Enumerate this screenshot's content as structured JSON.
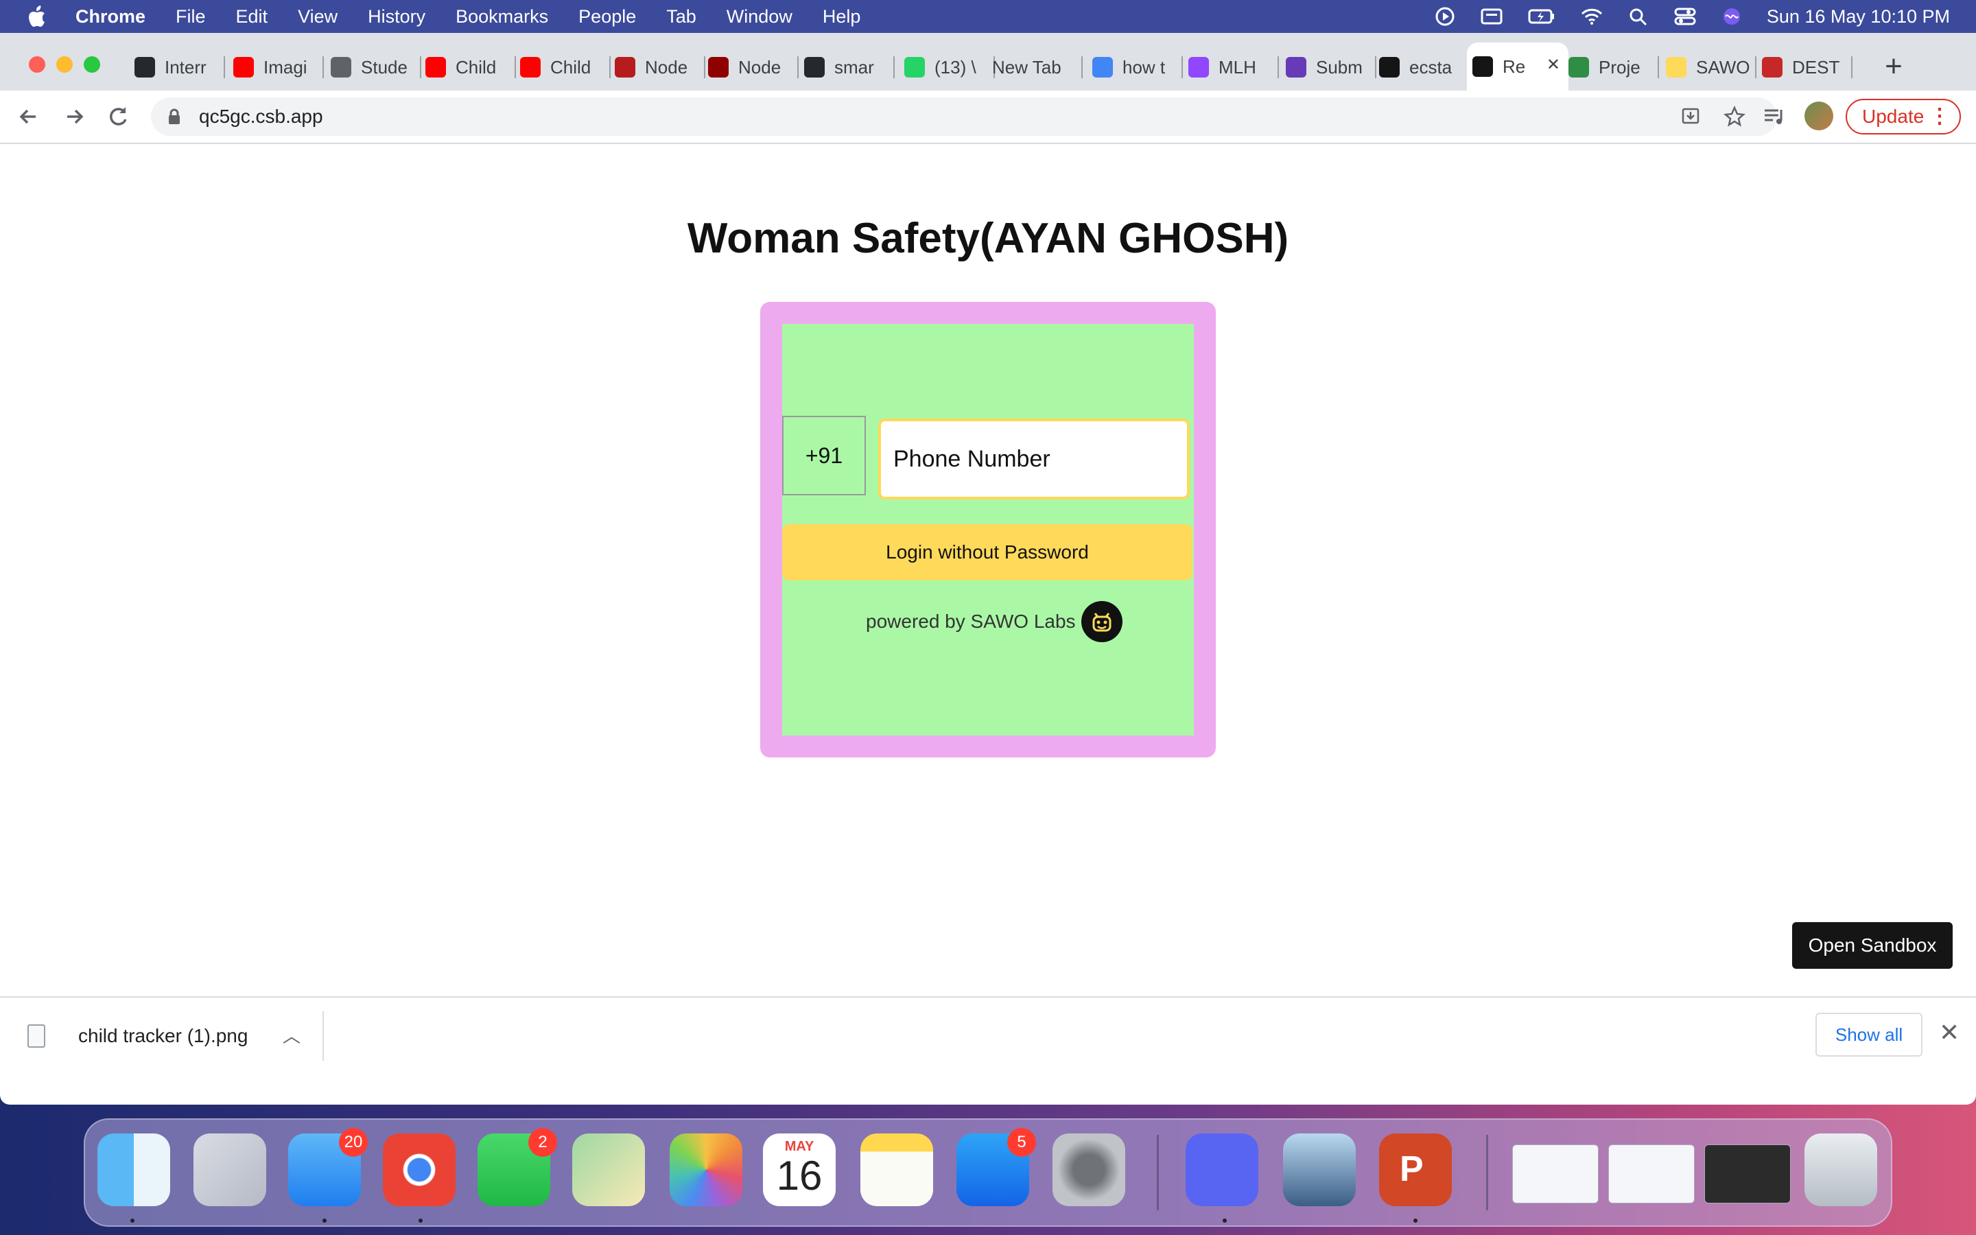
{
  "menubar": {
    "app": "Chrome",
    "items": [
      "File",
      "Edit",
      "View",
      "History",
      "Bookmarks",
      "People",
      "Tab",
      "Window",
      "Help"
    ],
    "datetime": "Sun 16 May  10:10 PM"
  },
  "tabs": [
    {
      "label": "Interr",
      "icon": "github-icon",
      "color": "#24292e"
    },
    {
      "label": "Imagi",
      "icon": "youtube-icon",
      "color": "#ff0000"
    },
    {
      "label": "Stude",
      "icon": "globe-icon",
      "color": "#5f6368"
    },
    {
      "label": "Child",
      "icon": "youtube-icon",
      "color": "#ff0000"
    },
    {
      "label": "Child",
      "icon": "youtube-icon",
      "color": "#ff0000"
    },
    {
      "label": "Node",
      "icon": "node-icon",
      "color": "#b71c1c"
    },
    {
      "label": "Node",
      "icon": "node-red-icon",
      "color": "#8f0000"
    },
    {
      "label": "smar",
      "icon": "github-icon",
      "color": "#24292e"
    },
    {
      "label": "(13) \\",
      "icon": "whatsapp-icon",
      "color": "#25d366"
    },
    {
      "label": "New Tab",
      "icon": "",
      "color": ""
    },
    {
      "label": "how t",
      "icon": "google-icon",
      "color": "#4285f4"
    },
    {
      "label": "MLH",
      "icon": "twitch-icon",
      "color": "#9146ff"
    },
    {
      "label": "Subm",
      "icon": "form-icon",
      "color": "#673ab7"
    },
    {
      "label": "ecsta",
      "icon": "codesandbox-icon",
      "color": "#151515"
    },
    {
      "label": "Re",
      "icon": "codesandbox-icon",
      "color": "#151515",
      "active": true
    },
    {
      "label": "Proje",
      "icon": "gfg-icon",
      "color": "#2f8d46"
    },
    {
      "label": "SAWO",
      "icon": "sawo-icon",
      "color": "#ffd95a"
    },
    {
      "label": "DEST",
      "icon": "shield-icon",
      "color": "#c62828"
    }
  ],
  "address": "qc5gc.csb.app",
  "update_label": "Update",
  "page": {
    "title": "Woman Safety(AYAN GHOSH)",
    "country_code": "+91",
    "phone_placeholder": "Phone Number",
    "login_label": "Login without Password",
    "powered_by": "powered by SAWO Labs",
    "sandbox_label": "Open Sandbox",
    "colors": {
      "card_border": "#eeaaee",
      "card_bg": "#aaf8a6",
      "accent": "#ffd95a"
    }
  },
  "downloads": {
    "file": "child tracker (1).png",
    "show_all": "Show all"
  },
  "dock": {
    "apps": [
      "finder-icon",
      "launchpad-icon",
      "mail-icon",
      "chrome-icon",
      "facetime-icon",
      "maps-icon",
      "photos-icon",
      "calendar-icon",
      "notes-icon",
      "app-store-icon",
      "system-preferences-icon",
      "discord-icon",
      "preview-icon",
      "powerpoint-icon",
      "trash-icon"
    ],
    "mail_badge": "20",
    "facetime_badge": "2",
    "appstore_badge": "5",
    "calendar_month": "MAY",
    "calendar_day": "16"
  }
}
